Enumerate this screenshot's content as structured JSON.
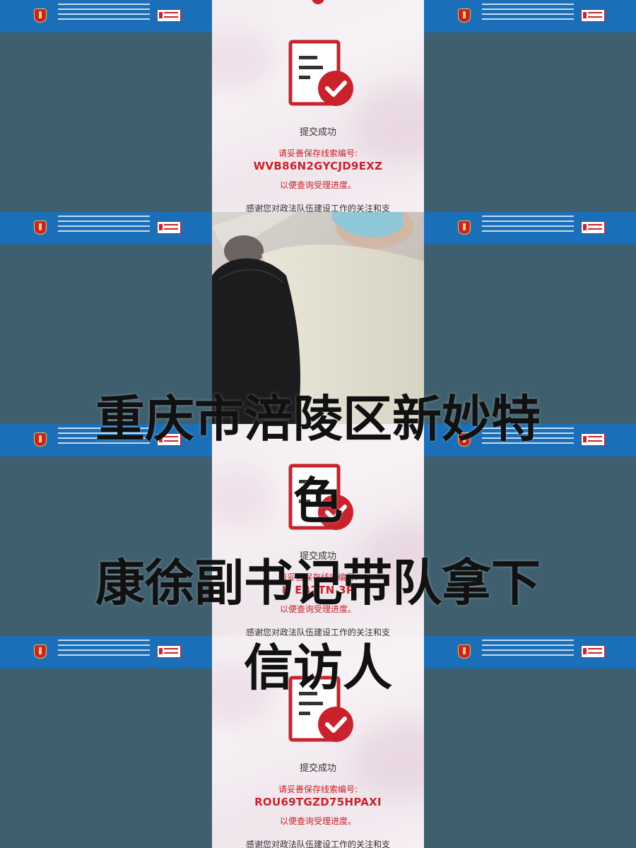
{
  "panels": [
    {
      "success": "提交成功",
      "hint": "请妥善保存线索编号:",
      "code": "WVB86N2GYCJD9EXZ",
      "hint2": "以便查询受理进度。",
      "thanks": "感谢您对政法队伍建设工作的关注和支"
    },
    {
      "success": "提交成功",
      "hint": "请妥善保存线索编号:",
      "code": "H  EB2TN    3P",
      "hint2": "以便查询受理进度。",
      "thanks": "感谢您对政法队伍建设工作的关注和支"
    },
    {
      "success": "提交成功",
      "hint": "请妥善保存线索编号:",
      "code": "ROU69TGZD75HPAXI",
      "hint2": "以便查询受理进度。",
      "thanks": "感谢您对政法队伍建设工作的关注和支"
    }
  ],
  "overlay": {
    "line1": "重庆市涪陵区新妙特",
    "line2": "色",
    "line3": "康徐副书记带队拿下",
    "line4": "信访人"
  },
  "colors": {
    "accent": "#c8232c",
    "banner": "#1a6fb8",
    "background": "#3f5f6e"
  },
  "icons": [
    "document-check-icon",
    "emblem-icon",
    "badge-icon"
  ]
}
